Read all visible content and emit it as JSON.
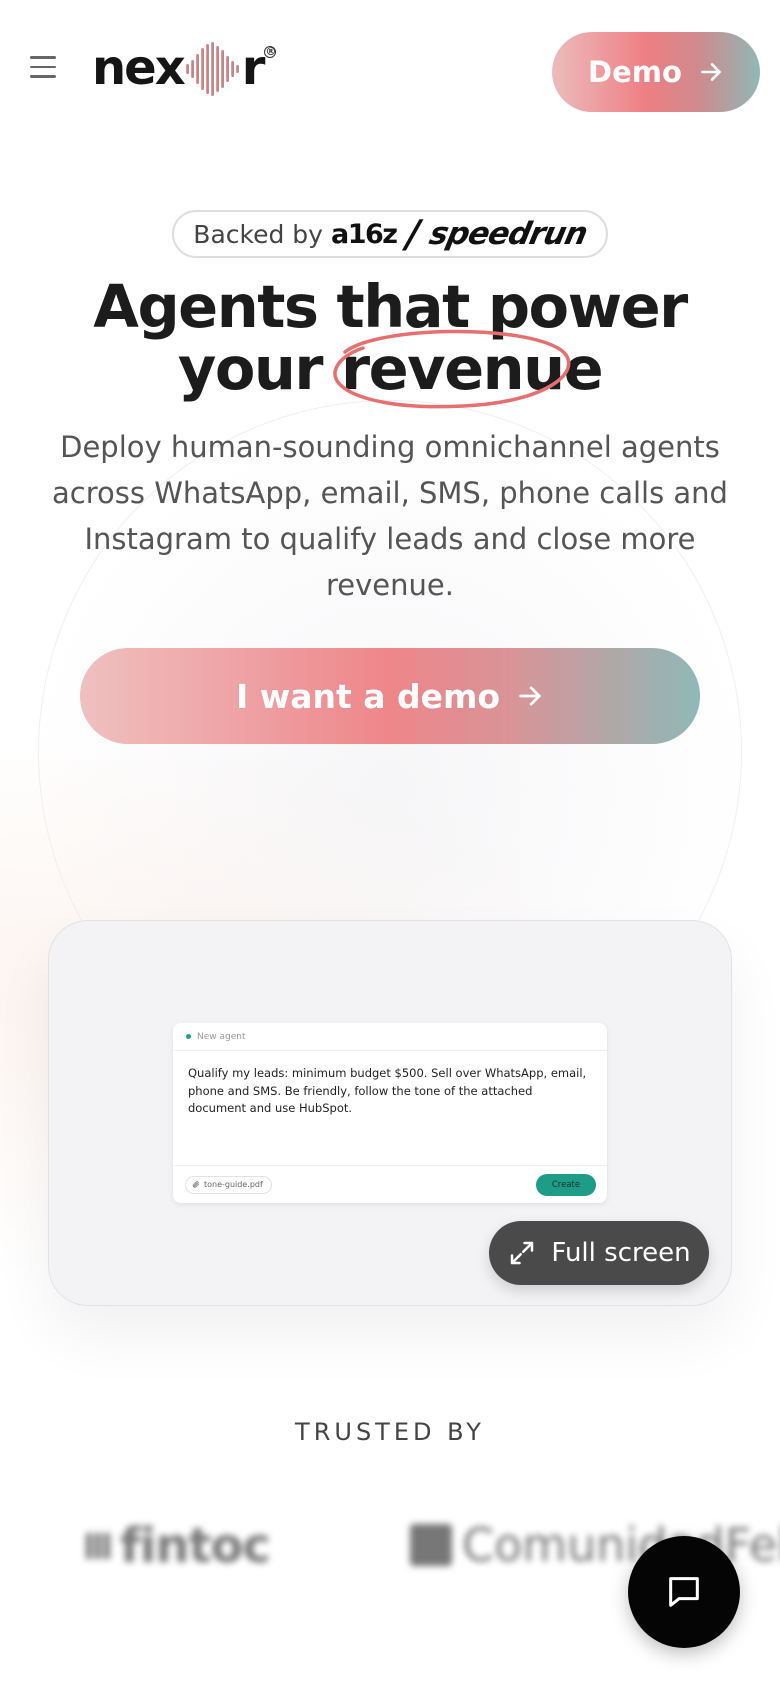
{
  "header": {
    "logo_prefix": "nex",
    "logo_suffix": "r",
    "demo_label": "Demo"
  },
  "badge": {
    "label": "Backed by",
    "partner1": "a16z",
    "partner2": "speedrun"
  },
  "hero": {
    "title_line1": "Agents that power",
    "title_line2_prefix": "your",
    "title_line2_highlight": "revenue",
    "description": "Deploy human-sounding omnichannel agents across WhatsApp, email, SMS, phone calls and Instagram to qualify leads and close more revenue.",
    "cta_label": "I want a demo"
  },
  "preview": {
    "card_title": "New agent",
    "prompt": "Qualify my leads: minimum budget $500. Sell over WhatsApp, email, phone and SMS. Be friendly, follow the tone of the attached document and use HubSpot.",
    "attachment": "tone-guide.pdf",
    "create_label": "Create",
    "fullscreen_label": "Full screen"
  },
  "trusted": {
    "heading": "TRUSTED BY",
    "logos": [
      "fintoc",
      "ComunidadFeliz"
    ]
  },
  "colors": {
    "accent_coral": "#ee7f84",
    "accent_teal": "#8fb8b6",
    "create_green": "#1e9c88"
  },
  "icons": [
    "menu-icon",
    "arrow-right-icon",
    "expand-icon",
    "chat-icon",
    "paperclip-icon"
  ]
}
